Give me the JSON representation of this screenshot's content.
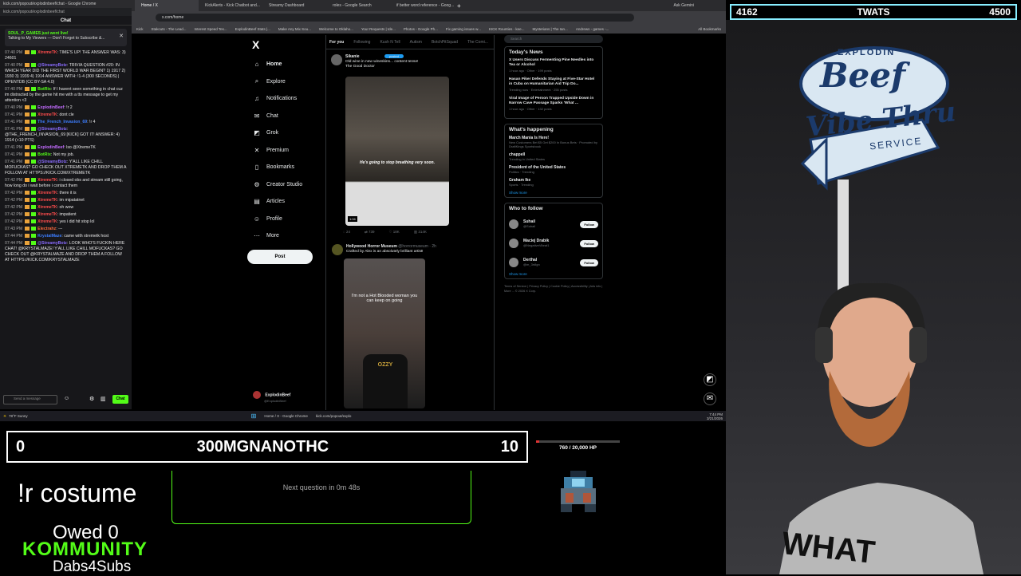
{
  "chat_window": {
    "title_bar": "kick.com/popout/explodinbeef/chat - Google Chrome",
    "url": "kick.com/popout/explodinbeef/chat",
    "heading": "Chat",
    "pinned_user": "SOUL_P_GAMES just went live!",
    "pinned_text": "Talking to My Viewers — Don't Forget to Subscribe &...",
    "messages": [
      {
        "time": "07:40 PM",
        "user": "XtremeTK",
        "color": "#ff4d4d",
        "text": ": TIME'S UP! THE ANSWER WAS: 3) 24601"
      },
      {
        "time": "07:40 PM",
        "user": "@StreamyBotz",
        "color": "#8a6cff",
        "text": ": TRIVIA QUESTION #20: IN WHICH YEAR DID THE FIRST WORLD WAR BEGIN? 1) 1917 2) 1930 3) 1939 4) 1914 ANSWER WITH: !1-4 (300 SECONDS) | OPENTDB (CC BY-SA 4.0)"
      },
      {
        "time": "07:40 PM",
        "user": "BotRix",
        "color": "#53fc18",
        "text": ": If I havent seen something in chat cuz im distracted by the game hit me with a tts message to get my attention <3"
      },
      {
        "time": "07:40 PM",
        "user": "ExplodinBeef",
        "color": "#c36bff",
        "text": ": !r 2"
      },
      {
        "time": "07:41 PM",
        "user": "XtremeTK",
        "color": "#ff4d4d",
        "text": ": dont cle"
      },
      {
        "time": "07:41 PM",
        "user": "The_French_Invasion_69",
        "color": "#3d7eff",
        "text": ": !r 4"
      },
      {
        "time": "07:41 PM",
        "user": "@StreamyBotz",
        "color": "#8a6cff",
        "text": ": @THE_FRENCH_INVASION_69 [KICK] GOT IT! ANSWER: 4) 1914 (+10 PTS)"
      },
      {
        "time": "07:41 PM",
        "user": "ExplodinBeef",
        "color": "#c36bff",
        "text": ": lso @XtremeTK"
      },
      {
        "time": "07:41 PM",
        "user": "BotRix",
        "color": "#53fc18",
        "text": ": Not my job."
      },
      {
        "time": "07:41 PM",
        "user": "@StreamyBotz",
        "color": "#8a6cff",
        "text": ": Y'ALL LIKE CHILL MOFUCKAS? GO CHECK OUT XTREMETK AND DROP THEM A FOLLOW AT HTTPS://KICK.COM/XTREMETK"
      },
      {
        "time": "07:42 PM",
        "user": "XtremeTK",
        "color": "#ff4d4d",
        "text": ": i closed obs and stream still going, how long do i wait before i contact them"
      },
      {
        "time": "07:42 PM",
        "user": "XtremeTK",
        "color": "#ff4d4d",
        "text": ": there it is"
      },
      {
        "time": "07:42 PM",
        "user": "XtremeTK",
        "color": "#ff4d4d",
        "text": ": im mipatatnet"
      },
      {
        "time": "07:42 PM",
        "user": "XtremeTK",
        "color": "#ff4d4d",
        "text": ": oh wow"
      },
      {
        "time": "07:42 PM",
        "user": "XtremeTK",
        "color": "#ff4d4d",
        "text": ": impatient"
      },
      {
        "time": "07:42 PM",
        "user": "XtremeTK",
        "color": "#ff4d4d",
        "text": ": yes i did hit stop lol"
      },
      {
        "time": "07:43 PM",
        "user": "Electrahz",
        "color": "#ff6a3d",
        "text": ": ---"
      },
      {
        "time": "07:44 PM",
        "user": "KrystalMaze",
        "color": "#3d7eff",
        "text": ": came with xtremetk host"
      },
      {
        "time": "07:44 PM",
        "user": "@StreamyBotz",
        "color": "#8a6cff",
        "text": ": LOOK WHO'S FUCKIN HERE CHAT! @KRYSTALMAZE! Y'ALL LIKE CHILL MOFUCKAS? GO CHECK OUT @KRYSTALMAZE AND DROP THEM A FOLLOW AT HTTPS://KICK.COM/KRYSTALMAZE"
      }
    ],
    "input_placeholder": "Send a message",
    "send_label": "Chat"
  },
  "browser": {
    "tabs": [
      "Home / X",
      "KickAlerts - Kick Chatbot and...",
      "Streamy Dashboard",
      "roles - Google Search",
      "if better word reference - Goog..."
    ],
    "url": "x.com/home",
    "bookmarks": [
      "Kick",
      "Stakcuts - The Lead...",
      "Interest Speed Tes...",
      "ExplodinBeef Stats |...",
      "Make Any Mix Sou...",
      "Welcome to Oklaho...",
      "Your Requests | Ide...",
      "Photos - Google Ph...",
      "Fix gaming issues w...",
      "KICK Rounties - kee...",
      "Mysterians | The Ian...",
      "Andrews - games -..."
    ],
    "all_bookmarks": "All Bookmarks",
    "gemini": "Ask Gemini"
  },
  "x_nav": {
    "logo": "X",
    "items": [
      {
        "label": "Home",
        "icon": "home-icon",
        "glyph": "⌂"
      },
      {
        "label": "Explore",
        "icon": "search-icon",
        "glyph": "⌕"
      },
      {
        "label": "Notifications",
        "icon": "bell-icon",
        "glyph": "♫"
      },
      {
        "label": "Chat",
        "icon": "message-icon",
        "glyph": "✉"
      },
      {
        "label": "Grok",
        "icon": "grok-icon",
        "glyph": "◩"
      },
      {
        "label": "Premium",
        "icon": "premium-icon",
        "glyph": "✕"
      },
      {
        "label": "Bookmarks",
        "icon": "bookmark-icon",
        "glyph": "▯"
      },
      {
        "label": "Creator Studio",
        "icon": "creator-icon",
        "glyph": "⚙"
      },
      {
        "label": "Articles",
        "icon": "article-icon",
        "glyph": "▤"
      },
      {
        "label": "Profile",
        "icon": "profile-icon",
        "glyph": "☺"
      },
      {
        "label": "More",
        "icon": "more-icon",
        "glyph": "⋯"
      }
    ],
    "post_label": "Post",
    "account_name": "ExplodinBeef",
    "account_handle": "@ExplodinBeef"
  },
  "feed": {
    "tabs": [
      "For you",
      "Following",
      "Kush N Tell",
      "Autism",
      "BotchPitSquad",
      "The Comi..."
    ],
    "tweet1": {
      "name": "Sikanie",
      "text": "Old wine in new wineskins... content tense!",
      "subtext": "The Good Doctor",
      "caption": "He's going to stop breathing very soon.",
      "duration": "1:04",
      "stats": [
        "24",
        "739",
        "18K",
        "314K"
      ],
      "posted_label": "posted"
    },
    "tweet2": {
      "name": "Hollywood Horror Museum",
      "handle": "@horrormuseum · 2h",
      "text": "Crafted by Alex is an absolutely brilliant artist!",
      "caption": "I'm not a Hot Blooded woman you can keep on going"
    }
  },
  "right_col": {
    "search_placeholder": "Search",
    "news_title": "Today's News",
    "news": [
      {
        "title": "X Users Discuss Fermenting Pine Needles into Tea or Alcohol",
        "meta": "1 hour ago · Other · 199 posts"
      },
      {
        "title": "Hasan Piker Defends Staying at Five-Star Hotel in Cuba on Humanitarian Aid Trip Do...",
        "meta": "Trending now · Entertainment · 255 posts"
      },
      {
        "title": "Viral Image of Person Trapped Upside Down in Narrow Cave Passage Sparks 'What ...",
        "meta": "1 hour ago · Other · 132 posts"
      }
    ],
    "happening_title": "What's happening",
    "trends": [
      {
        "name": "March Mania Is Here!",
        "meta": "New Customers Bet $5 Get $200 In Bonus Bets · Promoted by DraftKings Sportsbook"
      },
      {
        "name": "chappell",
        "meta": "Trending in United States"
      },
      {
        "name": "President of the United States",
        "meta": "Politics · Trending"
      },
      {
        "name": "Graham Ike",
        "meta": "Sports · Trending"
      }
    ],
    "show_more": "Show more",
    "wtf_title": "Who to follow",
    "follow": [
      {
        "name": "Suhail",
        "handle": "@Suhail"
      },
      {
        "name": "Maciej Drabik",
        "handle": "@NegativeVibrat1"
      },
      {
        "name": "Derthal",
        "handle": "@m_3rdlgn"
      }
    ],
    "follow_label": "Follow",
    "footer": "Terms of Service | Privacy Policy | Cookie Policy | Accessibility | Ads info | More ... © 2026 X Corp."
  },
  "taskbar": {
    "weather_temp": "78°F",
    "weather_desc": "Sunny",
    "apps": [
      "Home / X - Google Chrome",
      "kick.com/popout/explo"
    ],
    "time": "7:44 PM",
    "date": "3/21/2026"
  },
  "overlay": {
    "top_left_score": "4162",
    "top_name": "TWATS",
    "top_right_score": "4500",
    "bottom_left_score": "0",
    "bottom_name": "300MGNANOTHC",
    "bottom_right_score": "10",
    "command": "!r costume",
    "next_question": "Next question in 0m 48s",
    "hp_text": "760 / 20,000 HP",
    "hp_fraction": 0.038,
    "owed": "Owed 0",
    "kommunity": "KOMMUNITY",
    "dabs": "Dabs4Subs"
  },
  "webcam": {
    "sign_top": "EXPLODIN",
    "sign_brand": "Beef",
    "sign_main": "Vibe Thru",
    "sign_sub": "SERVICE",
    "shirt_text": "WHAT"
  }
}
